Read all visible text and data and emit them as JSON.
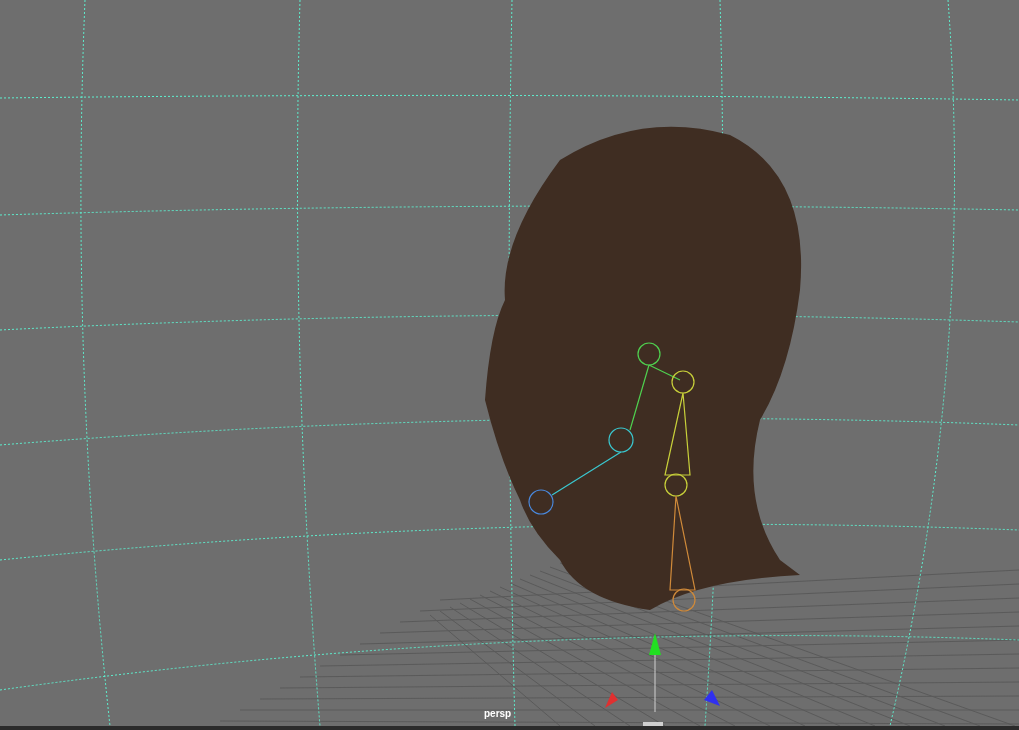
{
  "viewport": {
    "camera_label": "persp"
  }
}
